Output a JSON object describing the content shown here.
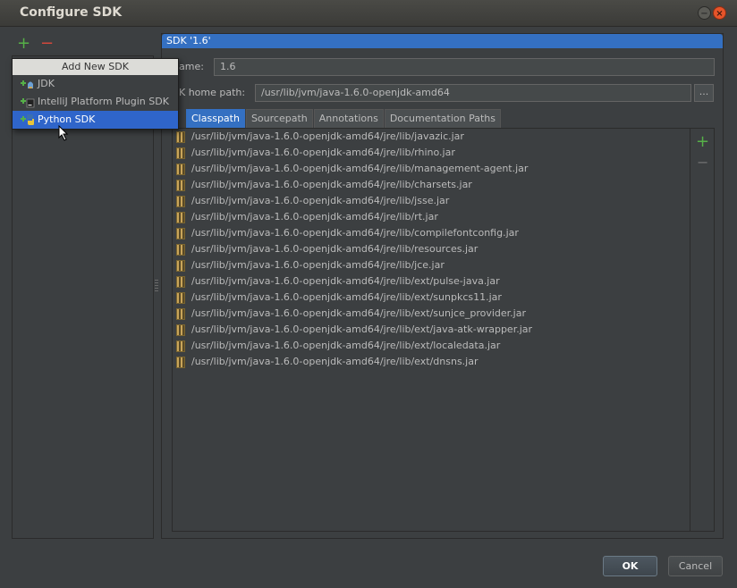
{
  "window": {
    "title": "Configure SDK",
    "minimize_glyph": "−",
    "close_glyph": "×"
  },
  "toolbar": {
    "add_glyph": "+",
    "remove_glyph": "−"
  },
  "popup": {
    "header": "Add New SDK",
    "items": [
      {
        "label": "JDK",
        "icon": "jdk-icon"
      },
      {
        "label": "IntelliJ Platform Plugin SDK",
        "icon": "plugin-sdk-icon"
      },
      {
        "label": "Python SDK",
        "icon": "python-icon",
        "selected": true
      }
    ]
  },
  "sdk": {
    "header": "SDK '1.6'",
    "name_label": "ame:",
    "name_value": "1.6",
    "home_label": "K home path:",
    "home_value": "/usr/lib/jvm/java-1.6.0-openjdk-amd64",
    "browse_label": "..."
  },
  "tabs": [
    {
      "label": "Classpath",
      "active": true
    },
    {
      "label": "Sourcepath"
    },
    {
      "label": "Annotations"
    },
    {
      "label": "Documentation Paths"
    }
  ],
  "classpath": [
    "/usr/lib/jvm/java-1.6.0-openjdk-amd64/jre/lib/javazic.jar",
    "/usr/lib/jvm/java-1.6.0-openjdk-amd64/jre/lib/rhino.jar",
    "/usr/lib/jvm/java-1.6.0-openjdk-amd64/jre/lib/management-agent.jar",
    "/usr/lib/jvm/java-1.6.0-openjdk-amd64/jre/lib/charsets.jar",
    "/usr/lib/jvm/java-1.6.0-openjdk-amd64/jre/lib/jsse.jar",
    "/usr/lib/jvm/java-1.6.0-openjdk-amd64/jre/lib/rt.jar",
    "/usr/lib/jvm/java-1.6.0-openjdk-amd64/jre/lib/compilefontconfig.jar",
    "/usr/lib/jvm/java-1.6.0-openjdk-amd64/jre/lib/resources.jar",
    "/usr/lib/jvm/java-1.6.0-openjdk-amd64/jre/lib/jce.jar",
    "/usr/lib/jvm/java-1.6.0-openjdk-amd64/jre/lib/ext/pulse-java.jar",
    "/usr/lib/jvm/java-1.6.0-openjdk-amd64/jre/lib/ext/sunpkcs11.jar",
    "/usr/lib/jvm/java-1.6.0-openjdk-amd64/jre/lib/ext/sunjce_provider.jar",
    "/usr/lib/jvm/java-1.6.0-openjdk-amd64/jre/lib/ext/java-atk-wrapper.jar",
    "/usr/lib/jvm/java-1.6.0-openjdk-amd64/jre/lib/ext/localedata.jar",
    "/usr/lib/jvm/java-1.6.0-openjdk-amd64/jre/lib/ext/dnsns.jar"
  ],
  "side_toolbar": {
    "add_glyph": "+",
    "remove_glyph": "−"
  },
  "buttons": {
    "ok": "OK",
    "cancel": "Cancel"
  },
  "colors": {
    "selection": "#2f65ca",
    "header_blue": "#3470c2",
    "add_green": "#56b048",
    "remove_red": "#d6483c"
  }
}
